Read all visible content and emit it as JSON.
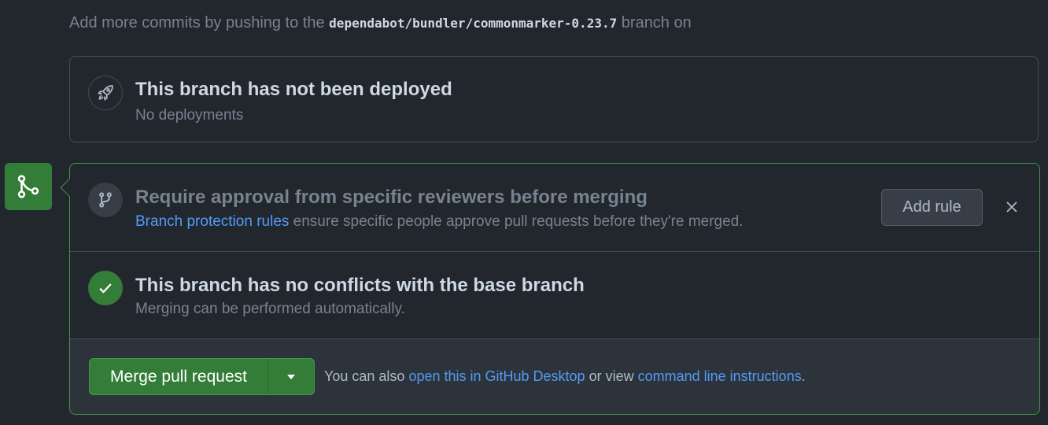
{
  "hint": {
    "prefix": "Add more commits by pushing to the",
    "branch": "dependabot/bundler/commonmarker-0.23.7",
    "suffix": "branch on"
  },
  "deploy": {
    "icon": "rocket-icon",
    "title": "This branch has not been deployed",
    "subtitle": "No deployments"
  },
  "merge_badge_icon": "git-merge-icon",
  "approval": {
    "icon": "git-branch-icon",
    "title": "Require approval from specific reviewers before merging",
    "link": "Branch protection rules",
    "text": "ensure specific people approve pull requests before they're merged.",
    "add_rule": "Add rule",
    "close_icon": "close-icon"
  },
  "conflicts": {
    "icon": "check-icon",
    "title": "This branch has no conflicts with the base branch",
    "subtitle": "Merging can be performed automatically."
  },
  "merge": {
    "button": "Merge pull request",
    "caret_icon": "triangle-down-icon",
    "also_prefix": "You can also",
    "desktop_link": "open this in GitHub Desktop",
    "or_view": "or view",
    "cli_link": "command line instructions",
    "period": "."
  },
  "colors": {
    "background": "#22272e",
    "success": "#347d39",
    "link": "#539bf5",
    "border": "#444c56"
  }
}
